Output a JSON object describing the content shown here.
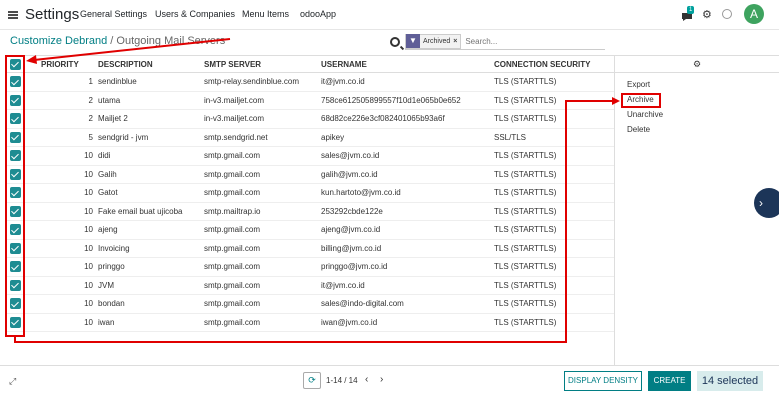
{
  "navbar": {
    "app_title": "Settings",
    "menus": [
      "General Settings",
      "Users & Companies",
      "Menu Items",
      "odooApp"
    ],
    "chat_badge": "1",
    "avatar_letter": "A"
  },
  "breadcrumb": {
    "parent": "Customize Debrand",
    "separator": " / ",
    "current": "Outgoing Mail Servers"
  },
  "search": {
    "facet_label": "Archived",
    "facet_close": "×",
    "placeholder": "Search..."
  },
  "table": {
    "headers": [
      "PRIORITY",
      "DESCRIPTION",
      "SMTP SERVER",
      "USERNAME",
      "CONNECTION SECURITY"
    ],
    "rows": [
      {
        "priority": "1",
        "description": "sendinblue",
        "smtp": "smtp-relay.sendinblue.com",
        "username": "it@jvm.co.id",
        "security": "TLS (STARTTLS)"
      },
      {
        "priority": "2",
        "description": "utama",
        "smtp": "in-v3.mailjet.com",
        "username": "758ce612505899557f10d1e065b0e652",
        "security": "TLS (STARTTLS)"
      },
      {
        "priority": "2",
        "description": "Mailjet 2",
        "smtp": "in-v3.mailjet.com",
        "username": "68d82ce226e3cf082401065b93a6f",
        "security": "TLS (STARTTLS)"
      },
      {
        "priority": "5",
        "description": "sendgrid - jvm",
        "smtp": "smtp.sendgrid.net",
        "username": "apikey",
        "security": "SSL/TLS"
      },
      {
        "priority": "10",
        "description": "didi",
        "smtp": "smtp.gmail.com",
        "username": "sales@jvm.co.id",
        "security": "TLS (STARTTLS)"
      },
      {
        "priority": "10",
        "description": "Galih",
        "smtp": "smtp.gmail.com",
        "username": "galih@jvm.co.id",
        "security": "TLS (STARTTLS)"
      },
      {
        "priority": "10",
        "description": "Gatot",
        "smtp": "smtp.gmail.com",
        "username": "kun.hartoto@jvm.co.id",
        "security": "TLS (STARTTLS)"
      },
      {
        "priority": "10",
        "description": "Fake email buat ujicoba",
        "smtp": "smtp.mailtrap.io",
        "username": "253292cbde122e",
        "security": "TLS (STARTTLS)"
      },
      {
        "priority": "10",
        "description": "ajeng",
        "smtp": "smtp.gmail.com",
        "username": "ajeng@jvm.co.id",
        "security": "TLS (STARTTLS)"
      },
      {
        "priority": "10",
        "description": "Invoicing",
        "smtp": "smtp.gmail.com",
        "username": "billing@jvm.co.id",
        "security": "TLS (STARTTLS)"
      },
      {
        "priority": "10",
        "description": "pringgo",
        "smtp": "smtp.gmail.com",
        "username": "pringgo@jvm.co.id",
        "security": "TLS (STARTTLS)"
      },
      {
        "priority": "10",
        "description": "JVM",
        "smtp": "smtp.gmail.com",
        "username": "it@jvm.co.id",
        "security": "TLS (STARTTLS)"
      },
      {
        "priority": "10",
        "description": "bondan",
        "smtp": "smtp.gmail.com",
        "username": "sales@indo-digital.com",
        "security": "TLS (STARTTLS)"
      },
      {
        "priority": "10",
        "description": "iwan",
        "smtp": "smtp.gmail.com",
        "username": "iwan@jvm.co.id",
        "security": "TLS (STARTTLS)"
      }
    ]
  },
  "actions_panel": {
    "header_icon": "gear-icon",
    "items": [
      "Export",
      "Archive",
      "Unarchive",
      "Delete"
    ]
  },
  "footer": {
    "pager_value": "1-14 / 14",
    "density_label": "DISPLAY DENSITY",
    "create_label": "CREATE",
    "selected_label": "14 selected"
  },
  "colors": {
    "accent": "#017e84",
    "checkbox": "#1e8c92",
    "annotation": "#e00000"
  }
}
